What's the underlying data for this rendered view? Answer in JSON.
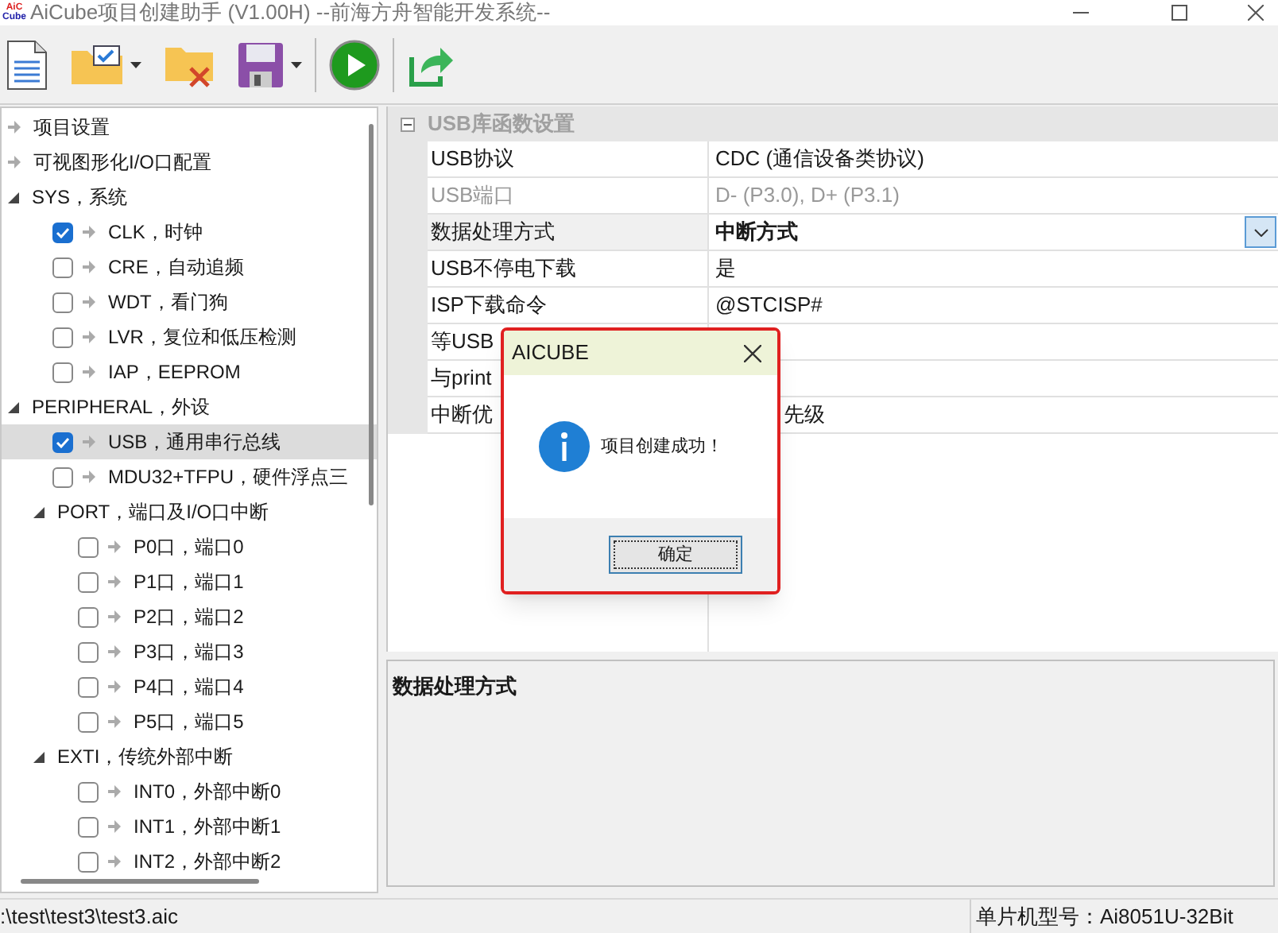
{
  "window": {
    "title": "AiCube项目创建助手 (V1.00H) --前海方舟智能开发系统--",
    "logo": {
      "line_1": "AiC",
      "line_2": "Cube"
    }
  },
  "toolbar": [
    {
      "kind": "new"
    },
    {
      "kind": "open",
      "dropdown": true
    },
    {
      "kind": "close"
    },
    {
      "kind": "save",
      "dropdown": true
    },
    {
      "kind": "separator"
    },
    {
      "kind": "run"
    },
    {
      "kind": "separator"
    },
    {
      "kind": "export"
    }
  ],
  "tree": {
    "items": [
      {
        "kind": "leaf",
        "label": "项目设置",
        "selected": false
      },
      {
        "kind": "leaf",
        "label": "可视图形化I/O口配置",
        "selected": false
      },
      {
        "kind": "group",
        "label": "SYS，系统",
        "expanded": true,
        "selected": false,
        "children": [
          {
            "kind": "check",
            "label": "CLK，时钟",
            "checked": true,
            "selected": false
          },
          {
            "kind": "check",
            "label": "CRE，自动追频",
            "checked": false,
            "selected": false
          },
          {
            "kind": "check",
            "label": "WDT，看门狗",
            "checked": false,
            "selected": false
          },
          {
            "kind": "check",
            "label": "LVR，复位和低压检测",
            "checked": false,
            "selected": false
          },
          {
            "kind": "check",
            "label": "IAP，EEPROM",
            "checked": false,
            "selected": false
          }
        ]
      },
      {
        "kind": "group",
        "label": "PERIPHERAL，外设",
        "expanded": true,
        "selected": false,
        "children": [
          {
            "kind": "check",
            "label": "USB，通用串行总线",
            "checked": true,
            "selected": true
          },
          {
            "kind": "check",
            "label": "MDU32+TFPU，硬件浮点三",
            "checked": false,
            "selected": false
          },
          {
            "kind": "group",
            "label": "PORT，端口及I/O口中断",
            "expanded": true,
            "selected": false,
            "children": [
              {
                "kind": "check",
                "label": "P0口，端口0",
                "checked": false,
                "selected": false
              },
              {
                "kind": "check",
                "label": "P1口，端口1",
                "checked": false,
                "selected": false
              },
              {
                "kind": "check",
                "label": "P2口，端口2",
                "checked": false,
                "selected": false
              },
              {
                "kind": "check",
                "label": "P3口，端口3",
                "checked": false,
                "selected": false
              },
              {
                "kind": "check",
                "label": "P4口，端口4",
                "checked": false,
                "selected": false
              },
              {
                "kind": "check",
                "label": "P5口，端口5",
                "checked": false,
                "selected": false
              }
            ]
          },
          {
            "kind": "group",
            "label": "EXTI，传统外部中断",
            "expanded": true,
            "selected": false,
            "children": [
              {
                "kind": "check",
                "label": "INT0，外部中断0",
                "checked": false,
                "selected": false
              },
              {
                "kind": "check",
                "label": "INT1，外部中断1",
                "checked": false,
                "selected": false
              },
              {
                "kind": "check",
                "label": "INT2，外部中断2",
                "checked": false,
                "selected": false
              }
            ]
          }
        ]
      }
    ]
  },
  "property_grid": {
    "category": {
      "label": "USB库函数设置",
      "expanded": true
    },
    "rows": [
      {
        "name": "USB协议",
        "value": "CDC (通信设备类协议)",
        "disabled": false,
        "selected": false
      },
      {
        "name": "USB端口",
        "value": "D- (P3.0), D+ (P3.1)",
        "disabled": true,
        "selected": false
      },
      {
        "name": "数据处理方式",
        "value": "中断方式",
        "disabled": false,
        "selected": true
      },
      {
        "name": "USB不停电下载",
        "value": "是",
        "disabled": false,
        "selected": false
      },
      {
        "name": "ISP下载命令",
        "value": "@STCISP#",
        "disabled": false,
        "selected": false
      },
      {
        "name": "等USB",
        "kind": "covered",
        "disabled": false,
        "selected": false
      },
      {
        "name": "与print",
        "kind": "covered",
        "disabled": false,
        "selected": false
      },
      {
        "name": "中断优",
        "value": "先级",
        "kind": "covered",
        "disabled": false,
        "selected": false
      }
    ]
  },
  "description": {
    "title": "数据处理方式"
  },
  "dialog": {
    "title": "AICUBE",
    "message": "项目创建成功！",
    "button": "确定"
  },
  "status_bar": {
    "file": ":\\test\\test3\\test3.aic",
    "chip": "单片机型号：Ai8051U-32Bit"
  }
}
